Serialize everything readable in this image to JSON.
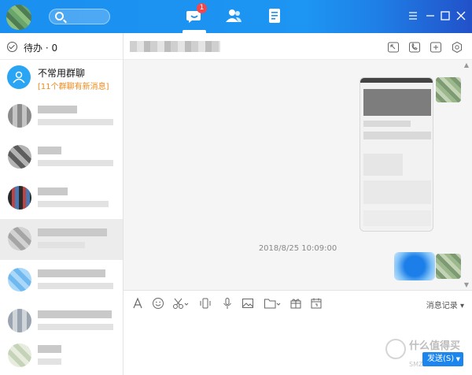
{
  "titlebar": {
    "chat_badge": "1",
    "icons": [
      "search-icon",
      "chat-icon",
      "contacts-icon",
      "files-icon",
      "menu-icon",
      "minimize-icon",
      "maximize-icon",
      "close-icon"
    ],
    "accent": "#1a8ff0"
  },
  "left": {
    "todo_label": "待办 · 0",
    "group": {
      "name": "不常用群聊",
      "sub": "[11个群聊有新消息]",
      "sub_color": "#f08a1c"
    }
  },
  "chat": {
    "timestamp": "2018/8/25 10:09:00"
  },
  "toolbar": {
    "history_label": "消息记录"
  },
  "input": {
    "send_label": "发送(S)"
  },
  "watermark": {
    "text": "什么值得买",
    "url": "SMZDM.COM"
  }
}
